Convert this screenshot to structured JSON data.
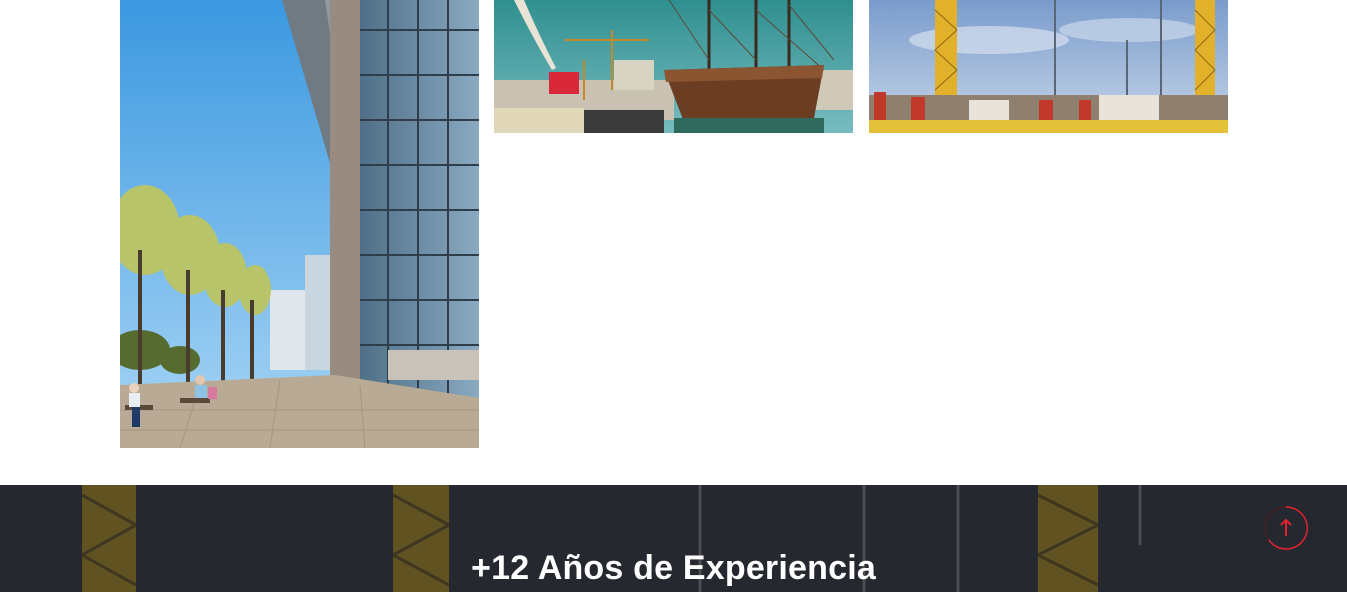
{
  "gallery": {
    "items": [
      {
        "subject": "glass office building with trees and people on benches"
      },
      {
        "subject": "historic wooden sailing ship in a harbor with cranes"
      },
      {
        "subject": "construction site with yellow tower cranes"
      }
    ]
  },
  "experience": {
    "title": "+12 Años de Experiencia"
  },
  "scroll_top": {
    "icon": "arrow-up-icon",
    "accent_color": "#e0242f"
  }
}
